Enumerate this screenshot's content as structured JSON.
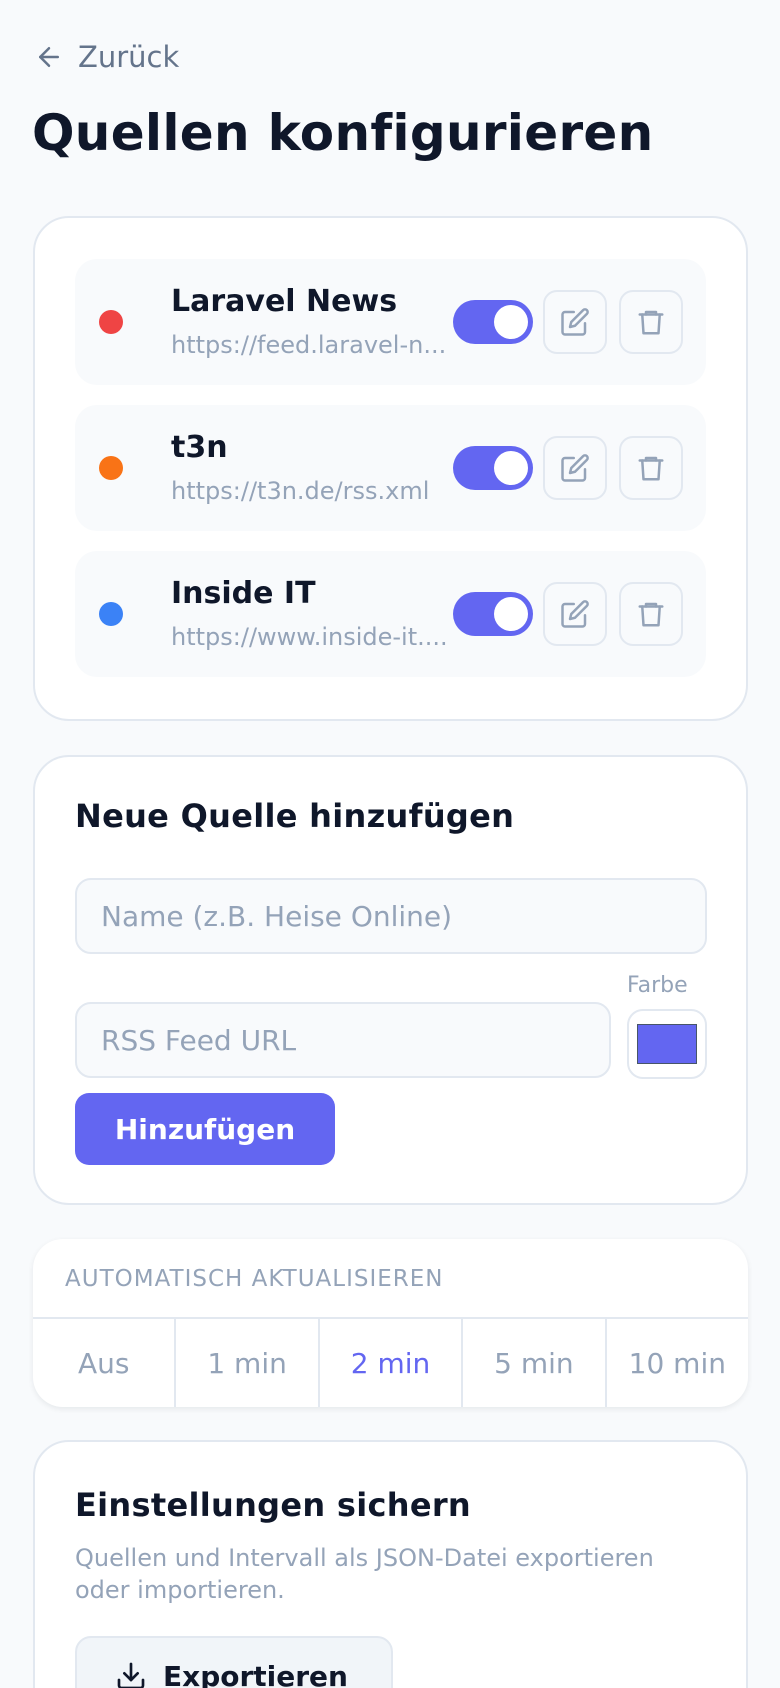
{
  "header": {
    "back_label": "Zurück",
    "title": "Quellen konfigurieren"
  },
  "sources": [
    {
      "name": "Laravel News",
      "url": "https://feed.laravel-n...",
      "color": "#ef4444",
      "enabled": true
    },
    {
      "name": "t3n",
      "url": "https://t3n.de/rss.xml",
      "color": "#f97316",
      "enabled": true
    },
    {
      "name": "Inside IT",
      "url": "https://www.inside-it....",
      "color": "#3b82f6",
      "enabled": true
    }
  ],
  "add_source": {
    "title": "Neue Quelle hinzufügen",
    "name_placeholder": "Name (z.B. Heise Online)",
    "url_placeholder": "RSS Feed URL",
    "color_label": "Farbe",
    "color_value": "#6366f1",
    "submit_label": "Hinzufügen"
  },
  "interval": {
    "label": "AUTOMATISCH AKTUALISIEREN",
    "options": [
      "Aus",
      "1 min",
      "2 min",
      "5 min",
      "10 min"
    ],
    "selected": "2 min"
  },
  "backup": {
    "title": "Einstellungen sichern",
    "description": "Quellen und Intervall als JSON-Datei exportieren oder importieren.",
    "export_label": "Exportieren"
  },
  "icons": {
    "back": "arrow-left-icon",
    "edit": "edit-icon",
    "delete": "trash-icon",
    "export": "download-icon"
  },
  "colors": {
    "accent": "#6366f1"
  }
}
